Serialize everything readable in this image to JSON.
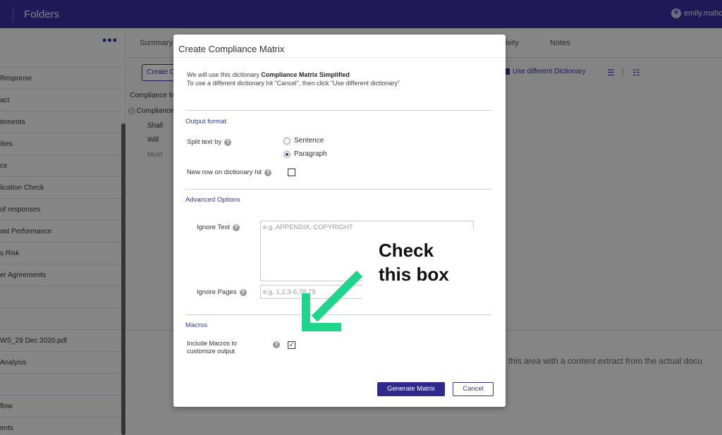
{
  "topbar": {
    "title": "Folders",
    "user": "emily.mahor"
  },
  "sidebar": {
    "menu_icon": "more-horizontal-icon",
    "items": [
      "Response",
      "act",
      "tements",
      "ities",
      "ce",
      "lication Check",
      "of responses",
      "ast Performance",
      "s Risk",
      "er Agreements",
      "",
      "",
      "WS_29 Dec 2020.pdf",
      "Analysis",
      "",
      "flow",
      "ents"
    ]
  },
  "main": {
    "tabs": [
      "Summary",
      "ivity",
      "Notes"
    ],
    "toolbar": {
      "create_label": "Create C",
      "use_dict_label": "Use different Dictionary"
    },
    "tree": {
      "header": "Compliance M",
      "root": "Compliance",
      "children": [
        "Shall",
        "Will",
        "Must"
      ]
    },
    "lower_text": "this area with a content extract from the actual docu"
  },
  "modal": {
    "title": "Create Compliance Matrix",
    "intro_line1_prefix": "We will use this dictionary",
    "intro_dictionary": "Compliance Matrix Simplified",
    "intro_line2": "To use a different dictionary hit \"Cancel\", then click \"Use different dictionary\"",
    "output_format": {
      "heading": "Output format",
      "split_label": "Split text by",
      "options": [
        "Sentence",
        "Paragraph"
      ],
      "selected": "Paragraph",
      "new_row_label": "New row on dictionary hit",
      "new_row_checked": false
    },
    "advanced": {
      "heading": "Advanced Options",
      "ignore_text_label": "Ignore Text",
      "ignore_text_placeholder": "e.g. APPENDIX, COPYRIGHT",
      "ignore_pages_label": "Ignore Pages",
      "ignore_pages_placeholder": "e.g. 1,2,3-6,78,79"
    },
    "macros": {
      "heading": "Macros",
      "include_label_line1": "Include Macros to",
      "include_label_line2": "customize output",
      "include_checked": true
    },
    "buttons": {
      "primary": "Generate Matrix",
      "secondary": "Cancel"
    }
  },
  "annotation": {
    "line1": "Check",
    "line2": "this box",
    "color": "#1fd58a"
  }
}
